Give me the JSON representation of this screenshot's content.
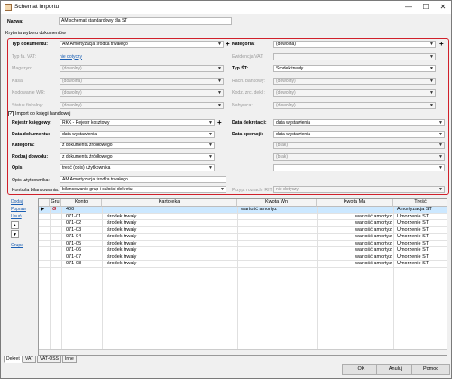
{
  "window": {
    "title": "Schemat importu",
    "minimize": "—",
    "maximize": "☐",
    "close": "✕"
  },
  "name": {
    "label": "Nazwa:",
    "value": "AM schemat standardowy dla ŚT"
  },
  "criteria_section": "Kryteria wyboru dokumentów",
  "left_fields": [
    {
      "label": "Typ dokumentu:",
      "value": "AM Amortyzacja środka trwałego",
      "bold": true,
      "disabled": false,
      "plus": true
    },
    {
      "label": "Typ fa. VAT:",
      "value": "nie dotyczy",
      "bold": false,
      "disabled": true,
      "link": true
    },
    {
      "label": "Magazyn:",
      "value": "(dowolny)",
      "bold": false,
      "disabled": true
    },
    {
      "label": "Kasa:",
      "value": "(dowolna)",
      "bold": false,
      "disabled": true
    },
    {
      "label": "Kodowanie WR:",
      "value": "(dowolny)",
      "bold": false,
      "disabled": true
    },
    {
      "label": "Status fiskalny:",
      "value": "(dowolny)",
      "bold": false,
      "disabled": true
    }
  ],
  "right_fields": [
    {
      "label": "Kategoria:",
      "value": "(dowolna)",
      "bold": true,
      "disabled": false,
      "plus": true
    },
    {
      "label": "Ewidencja VAT:",
      "value": "",
      "bold": false,
      "disabled": true
    },
    {
      "label": "Typ ŚT:",
      "value": "Środek trwały",
      "bold": true,
      "disabled": false
    },
    {
      "label": "Rach. bankowy:",
      "value": "(dowolny)",
      "bold": false,
      "disabled": true
    },
    {
      "label": "Kodz. zrc. dekl.:",
      "value": "(dowolny)",
      "bold": false,
      "disabled": true
    },
    {
      "label": "Nabywca:",
      "value": "(dowolny)",
      "bold": false,
      "disabled": true
    }
  ],
  "import_checkbox": {
    "label": "Import do księgi handlowej",
    "checked": "✓"
  },
  "left_import": [
    {
      "label": "Rejestr księgowy:",
      "value": "RKK - Rejestr kosztowy",
      "bold": true,
      "disabled": false,
      "plus": true
    },
    {
      "label": "Data dokumentu:",
      "value": "data wystawienia",
      "bold": true,
      "disabled": false
    },
    {
      "label": "Kategoria:",
      "value": "z dokumentu źródłowego",
      "bold": true,
      "disabled": false
    },
    {
      "label": "Rodzaj dowodu:",
      "value": "z dokumentu źródłowego",
      "bold": true,
      "disabled": false
    },
    {
      "label": "Opis:",
      "value": "treść (opis) użytkownika",
      "bold": true,
      "disabled": false
    }
  ],
  "right_import": [
    {
      "label": "Data dekretacji:",
      "value": "data wystawienia",
      "bold": true,
      "disabled": false
    },
    {
      "label": "Data operacji:",
      "value": "data wystawienia",
      "bold": true,
      "disabled": false
    },
    {
      "label": "",
      "value": "(brak)",
      "bold": false,
      "disabled": true
    },
    {
      "label": "",
      "value": "(brak)",
      "bold": false,
      "disabled": true
    },
    {
      "label": "",
      "value": "",
      "bold": false,
      "disabled": false
    }
  ],
  "opis_uzytkownika": {
    "label": "Opis użytkownika:",
    "value": "AM Amortyzacja środka trwałego"
  },
  "kontrola": {
    "label": "Kontrola bilansowania:",
    "value": "bilansowanie grup i całości dekretu"
  },
  "przyp": {
    "label": "Przyp. rozrach. RIT:",
    "value": "nie dotyczy"
  },
  "side_links": {
    "dodaj": "Dodaj",
    "popraw": "Popraw",
    "usun": "Usuń",
    "grupa": "Grupa"
  },
  "grid": {
    "columns": [
      "",
      "Gru",
      "Konto",
      "Kartoteka",
      "Kwota Wn",
      "Kwota Ma",
      "Treść"
    ],
    "rows": [
      {
        "arrow": "▶",
        "g": "G",
        "konto": "400",
        "kart": "",
        "wn": "wartość amortyz",
        "ma": "",
        "tresc": "Amortyzacja ŚT",
        "selected": true
      },
      {
        "arrow": "",
        "g": "",
        "konto": "071-01",
        "kart": "środek trwały",
        "wn": "",
        "ma": "wartość amortyz",
        "tresc": "Umorzenie ŚT",
        "selected": false
      },
      {
        "arrow": "",
        "g": "",
        "konto": "071-02",
        "kart": "środek trwały",
        "wn": "",
        "ma": "wartość amortyz",
        "tresc": "Umorzenie ŚT",
        "selected": false
      },
      {
        "arrow": "",
        "g": "",
        "konto": "071-03",
        "kart": "środek trwały",
        "wn": "",
        "ma": "wartość amortyz",
        "tresc": "Umorzenie ŚT",
        "selected": false
      },
      {
        "arrow": "",
        "g": "",
        "konto": "071-04",
        "kart": "środek trwały",
        "wn": "",
        "ma": "wartość amortyz",
        "tresc": "Umorzenie ŚT",
        "selected": false
      },
      {
        "arrow": "",
        "g": "",
        "konto": "071-05",
        "kart": "środek trwały",
        "wn": "",
        "ma": "wartość amortyz",
        "tresc": "Umorzenie ŚT",
        "selected": false
      },
      {
        "arrow": "",
        "g": "",
        "konto": "071-06",
        "kart": "środek trwały",
        "wn": "",
        "ma": "wartość amortyz",
        "tresc": "Umorzenie ŚT",
        "selected": false
      },
      {
        "arrow": "",
        "g": "",
        "konto": "071-07",
        "kart": "środek trwały",
        "wn": "",
        "ma": "wartość amortyz",
        "tresc": "Umorzenie ŚT",
        "selected": false
      },
      {
        "arrow": "",
        "g": "",
        "konto": "071-08",
        "kart": "środek trwały",
        "wn": "",
        "ma": "wartość amortyz",
        "tresc": "Umorzenie ŚT",
        "selected": false
      }
    ]
  },
  "tabs": [
    "Dekret",
    "VAT",
    "VAT-OSS",
    "Inne"
  ],
  "buttons": {
    "ok": "OK",
    "cancel": "Anuluj",
    "help": "Pomoc"
  },
  "colors": {
    "accent_red": "#d0202a",
    "selection": "#cce8ff",
    "link": "#1a5fb4"
  }
}
